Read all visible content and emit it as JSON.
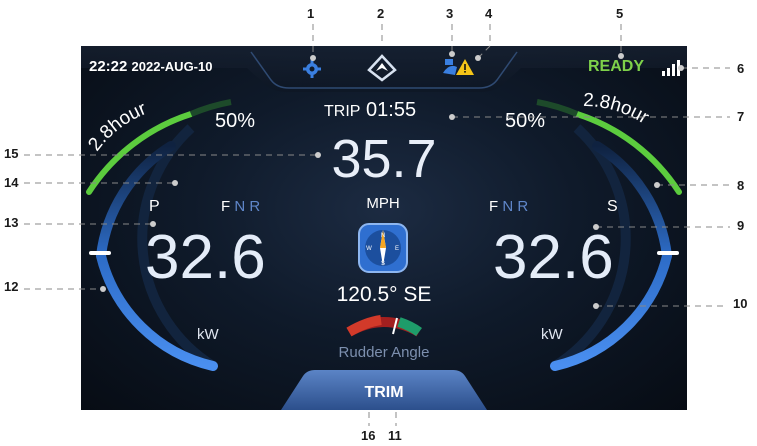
{
  "callouts": [
    "1",
    "2",
    "3",
    "4",
    "5",
    "6",
    "7",
    "8",
    "9",
    "10",
    "11",
    "12",
    "13",
    "14",
    "15",
    "16"
  ],
  "status": {
    "time": "22:22",
    "date": "2022-AUG-10",
    "ready": "READY"
  },
  "top_icons": [
    "settings-gear-icon",
    "navigation-arrow-icon",
    "engine-warning-icon",
    "signal-bars-icon"
  ],
  "trip": {
    "label": "TRIP",
    "value": "01:55"
  },
  "speed": {
    "value": "35.7",
    "unit": "MPH"
  },
  "heading": {
    "value": "120.5° SE"
  },
  "compass": {
    "N": "N",
    "E": "E",
    "S": "S",
    "W": "W"
  },
  "rudder": {
    "label": "Rudder Angle"
  },
  "left_motor": {
    "side": "P",
    "gear_active": "F",
    "gear_inactive": "N R",
    "power": "32.6",
    "unit": "kW",
    "battery_pct": "50%",
    "battery_pct_value": 50,
    "time_remaining": "2.8hour"
  },
  "right_motor": {
    "side": "S",
    "gear_active": "F",
    "gear_inactive": "N R",
    "power": "32.6",
    "unit": "kW",
    "battery_pct": "50%",
    "battery_pct_value": 50,
    "time_remaining": "2.8hour"
  },
  "trim": {
    "label": "TRIM"
  },
  "colors": {
    "accent_green": "#7ed14a",
    "accent_blue": "#3a7fe0",
    "warning_yellow": "#f5c518"
  }
}
